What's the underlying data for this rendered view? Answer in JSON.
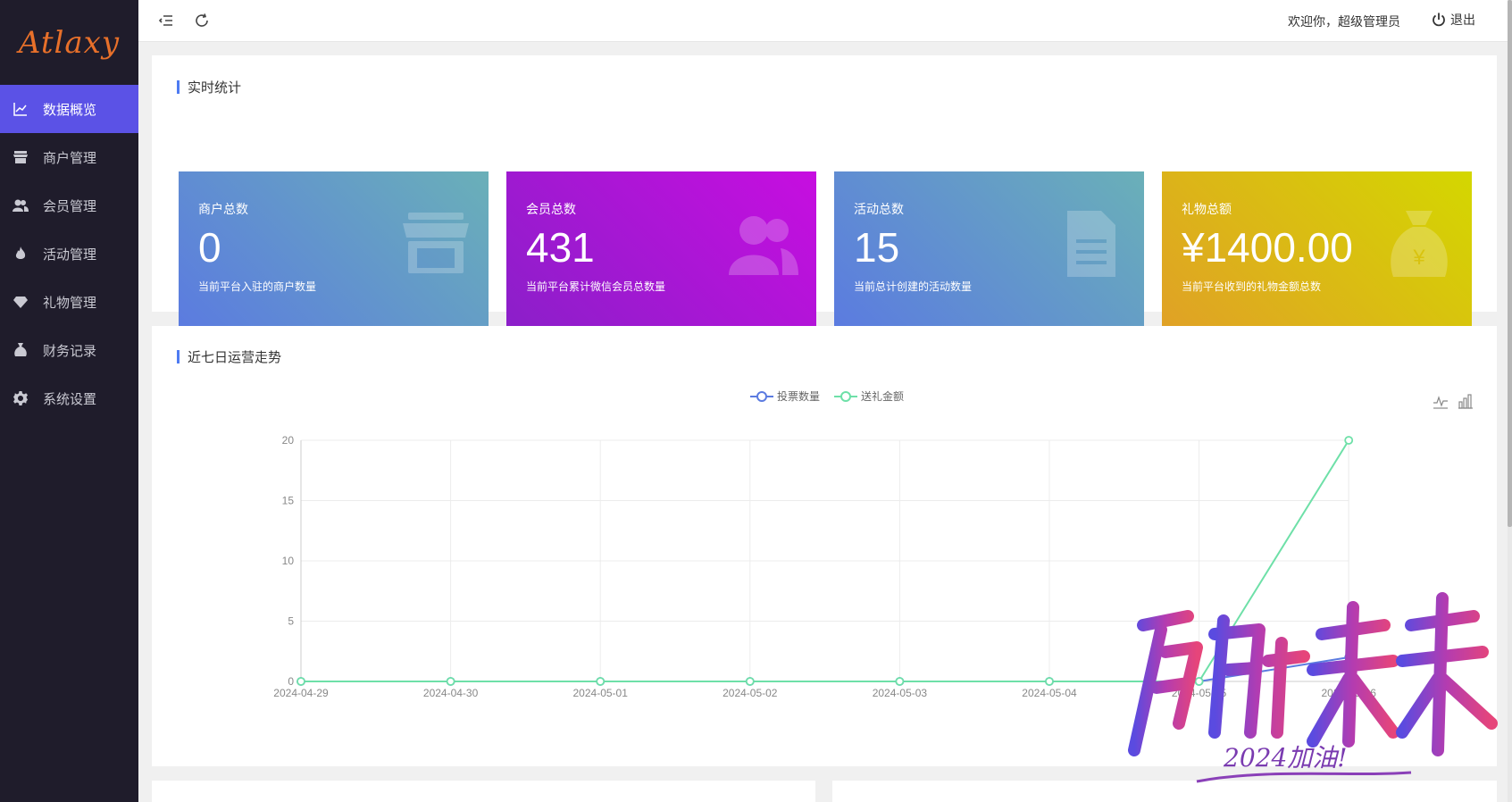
{
  "app": {
    "logo": "Atlaxy"
  },
  "sidebar": {
    "items": [
      {
        "label": "数据概览",
        "icon": "chart-line-icon",
        "active": true
      },
      {
        "label": "商户管理",
        "icon": "store-icon",
        "active": false
      },
      {
        "label": "会员管理",
        "icon": "users-icon",
        "active": false
      },
      {
        "label": "活动管理",
        "icon": "fire-icon",
        "active": false
      },
      {
        "label": "礼物管理",
        "icon": "gem-icon",
        "active": false
      },
      {
        "label": "财务记录",
        "icon": "money-bag-icon",
        "active": false
      },
      {
        "label": "系统设置",
        "icon": "gear-icon",
        "active": false
      }
    ]
  },
  "header": {
    "welcome": "欢迎你，超级管理员",
    "logout": "退出"
  },
  "stats": {
    "title": "实时统计",
    "cards": [
      {
        "label": "商户总数",
        "value": "0",
        "desc": "当前平台入驻的商户数量",
        "icon": "store-icon",
        "colors": [
          "#5b7be0",
          "#6ab0b8"
        ]
      },
      {
        "label": "会员总数",
        "value": "431",
        "desc": "当前平台累计微信会员总数量",
        "icon": "users-icon",
        "colors": [
          "#8b1fc9",
          "#c70ee0"
        ]
      },
      {
        "label": "活动总数",
        "value": "15",
        "desc": "当前总计创建的活动数量",
        "icon": "document-icon",
        "colors": [
          "#5b7be0",
          "#6ab0b8"
        ]
      },
      {
        "label": "礼物总额",
        "value": "¥1400.00",
        "desc": "当前平台收到的礼物金额总数",
        "icon": "money-bag-icon",
        "colors": [
          "#e0a126",
          "#d4d700"
        ]
      }
    ]
  },
  "trend": {
    "title": "近七日运营走势"
  },
  "chart_data": {
    "type": "line",
    "categories": [
      "2024-04-29",
      "2024-04-30",
      "2024-05-01",
      "2024-05-02",
      "2024-05-03",
      "2024-05-04",
      "2024-05-05",
      "2024-05-06"
    ],
    "series": [
      {
        "name": "投票数量",
        "values": [
          0,
          0,
          0,
          0,
          0,
          0,
          0,
          2
        ],
        "color": "#5b7be0"
      },
      {
        "name": "送礼金额",
        "values": [
          0,
          0,
          0,
          0,
          0,
          0,
          0,
          20
        ],
        "color": "#6ee0a8"
      }
    ],
    "yticks": [
      0,
      5,
      10,
      15,
      20
    ],
    "ylim": [
      0,
      20
    ],
    "grid": true,
    "legend": "top-center"
  },
  "toolbox": {
    "icons": [
      "line-chart-icon",
      "bar-chart-icon"
    ]
  },
  "watermark": {
    "text": "启航未来",
    "subtext": "2024加油!"
  }
}
